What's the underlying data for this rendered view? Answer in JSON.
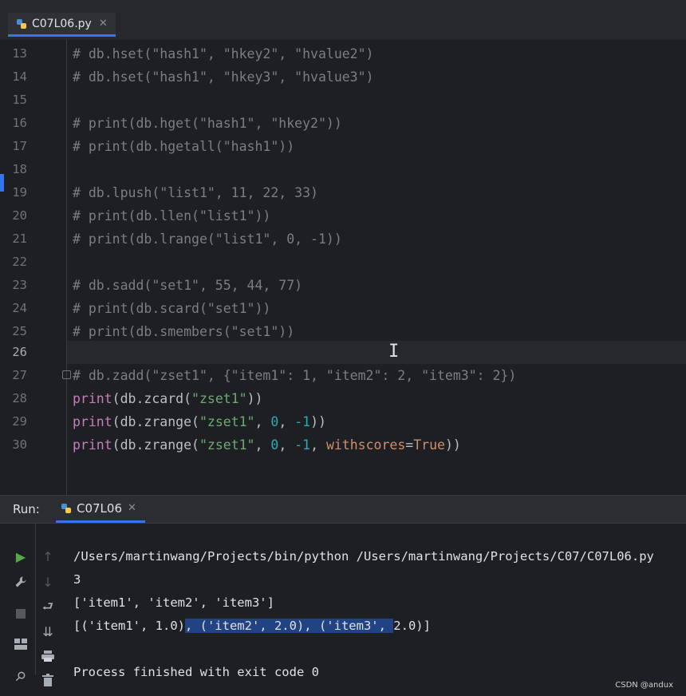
{
  "tab": {
    "filename": "C07L06.py",
    "close_glyph": "✕"
  },
  "editor": {
    "current_line": "26",
    "lines": [
      {
        "n": "13",
        "text": "# db.hset(\"hash1\", \"hkey2\", \"hvalue2\")"
      },
      {
        "n": "14",
        "text": "# db.hset(\"hash1\", \"hkey3\", \"hvalue3\")"
      },
      {
        "n": "15",
        "text": ""
      },
      {
        "n": "16",
        "text": "# print(db.hget(\"hash1\", \"hkey2\"))"
      },
      {
        "n": "17",
        "text": "# print(db.hgetall(\"hash1\"))"
      },
      {
        "n": "18",
        "text": ""
      },
      {
        "n": "19",
        "text": "# db.lpush(\"list1\", 11, 22, 33)"
      },
      {
        "n": "20",
        "text": "# print(db.llen(\"list1\"))"
      },
      {
        "n": "21",
        "text": "# print(db.lrange(\"list1\", 0, -1))"
      },
      {
        "n": "22",
        "text": ""
      },
      {
        "n": "23",
        "text": "# db.sadd(\"set1\", 55, 44, 77)"
      },
      {
        "n": "24",
        "text": "# print(db.scard(\"set1\"))"
      },
      {
        "n": "25",
        "text": "# print(db.smembers(\"set1\"))"
      },
      {
        "n": "26",
        "text": ""
      },
      {
        "n": "27",
        "text": "# db.zadd(\"zset1\", {\"item1\": 1, \"item2\": 2, \"item3\": 2})"
      }
    ],
    "code_lines": {
      "l28": {
        "n": "28",
        "fn": "print",
        "a": "(db.zcard(",
        "s1": "\"zset1\"",
        "b": "))"
      },
      "l29": {
        "n": "29",
        "fn": "print",
        "a": "(db.zrange(",
        "s1": "\"zset1\"",
        "c1": ", ",
        "n1": "0",
        "c2": ", ",
        "n2": "-1",
        "b": "))"
      },
      "l30": {
        "n": "30",
        "fn": "print",
        "a": "(db.zrange(",
        "s1": "\"zset1\"",
        "c1": ", ",
        "n1": "0",
        "c2": ", ",
        "n2": "-1",
        "c3": ", ",
        "kw": "withscores",
        "eq": "=",
        "kv": "True",
        "b": "))"
      }
    }
  },
  "run": {
    "label": "Run:",
    "tab_name": "C07L06",
    "close_glyph": "✕",
    "output": {
      "cmd": "/Users/martinwang/Projects/bin/python /Users/martinwang/Projects/C07/C07L06.py",
      "l1": "3",
      "l2": "['item1', 'item2', 'item3']",
      "l3_pre": "[('item1', 1.0)",
      "l3_sel": ", ('item2', 2.0), ('item3', ",
      "l3_post": "2.0)]",
      "l4": "",
      "l5": "Process finished with exit code 0"
    },
    "toolbar_icons": [
      "run-icon",
      "wrench-icon",
      "stop-icon",
      "layout-icon",
      "pin-icon",
      "up-arrow-icon",
      "down-arrow-icon",
      "soft-wrap-icon",
      "scroll-to-end-icon",
      "print-icon",
      "trash-icon"
    ]
  },
  "watermark": "CSDN @andux",
  "colors": {
    "accent": "#3574f0",
    "selection": "#214283",
    "string": "#6aab73",
    "number": "#2aacb8",
    "function": "#c77dbb",
    "keyword_arg": "#cf8e6d",
    "comment": "#7a7e85"
  }
}
